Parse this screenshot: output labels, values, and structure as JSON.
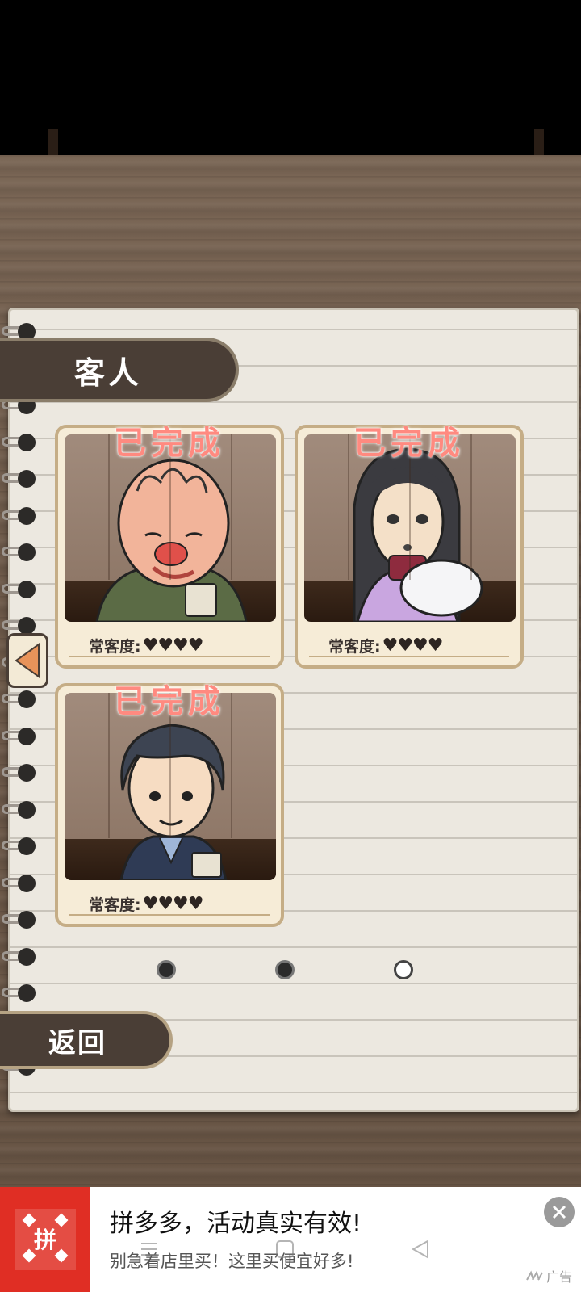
{
  "screen": {
    "title": "客人",
    "back_label": "返回"
  },
  "customers": [
    {
      "stamp": "已完成",
      "rating_label": "常客度:",
      "hearts": "♥♥♥♥",
      "rating_value": "4/4"
    },
    {
      "stamp": "已完成",
      "rating_label": "常客度:",
      "hearts": "♥♥♥♥",
      "rating_value": "4/4"
    },
    {
      "stamp": "已完成",
      "rating_label": "常客度:",
      "hearts": "♥♥♥♥",
      "rating_value": "4/4"
    }
  ],
  "pagination": {
    "total": 3,
    "current": 3
  },
  "ad": {
    "logo_text": "拼",
    "headline": "拼多多，活动真实有效!",
    "subtitle": "别急着店里买！这里买便宜好多!",
    "label": "广告"
  },
  "colors": {
    "stamp": "#ff8a80",
    "tab_bg": "#4a3e36",
    "arrow": "#e8935a",
    "ad_brand": "#e02e24"
  }
}
